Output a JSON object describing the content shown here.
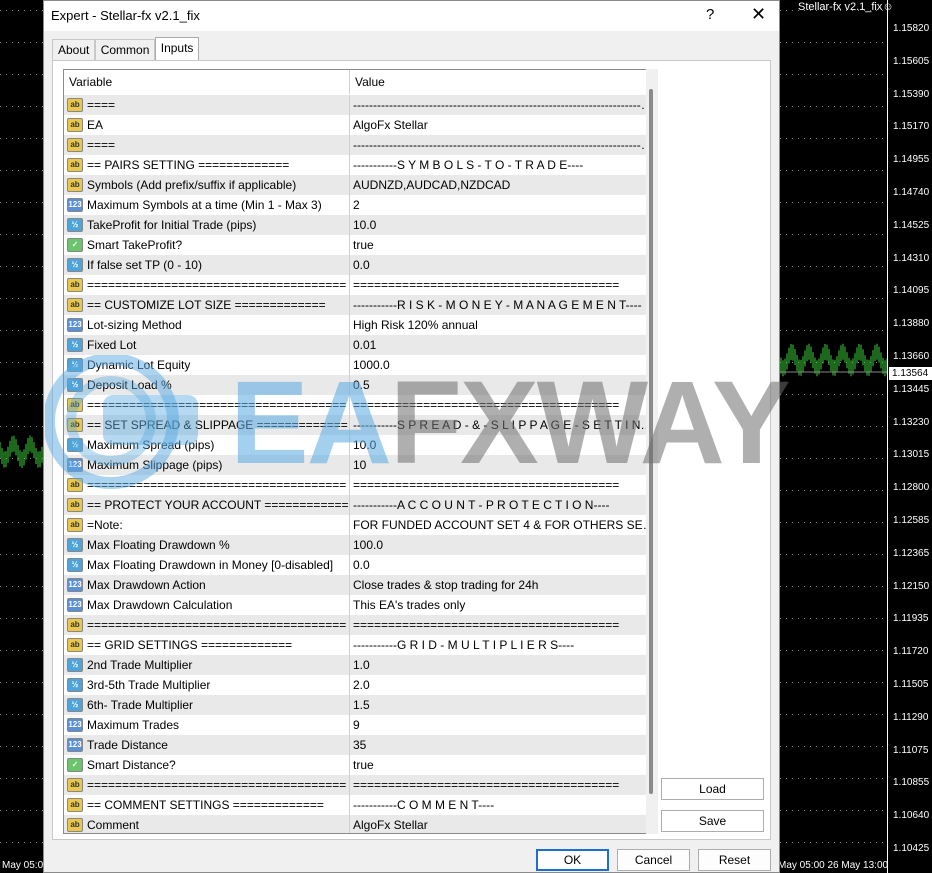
{
  "chart": {
    "title": "Stellar-fx v2.1_fix",
    "prices": [
      "1.15820",
      "1.15605",
      "1.15390",
      "1.15170",
      "1.14955",
      "1.14740",
      "1.14525",
      "1.14310",
      "1.14095",
      "1.13880",
      "1.13660",
      "1.13445",
      "1.13230",
      "1.13015",
      "1.12800",
      "1.12585",
      "1.12365",
      "1.12150",
      "1.11935",
      "1.11720",
      "1.11505",
      "1.11290",
      "1.11075",
      "1.10855",
      "1.10640",
      "1.10425"
    ],
    "current_price": "1.13564",
    "time_left": "May 05:0",
    "time_right": "May 05:00  26 May 13:00"
  },
  "dialog": {
    "title": "Expert - Stellar-fx v2.1_fix",
    "help": "?",
    "close": "✕",
    "tabs": [
      "About",
      "Common",
      "Inputs"
    ],
    "columns": {
      "variable": "Variable",
      "value": "Value"
    },
    "rows": [
      {
        "icon": "ab",
        "var": "====",
        "val": "--------------------------------------------------------------------------------"
      },
      {
        "icon": "ab",
        "var": "EA",
        "val": "AlgoFx Stellar"
      },
      {
        "icon": "ab",
        "var": "====",
        "val": "--------------------------------------------------------------------------------"
      },
      {
        "icon": "ab",
        "var": "== PAIRS SETTING =============",
        "val": "-----------S Y M B O L S - T O - T R A D E----"
      },
      {
        "icon": "ab",
        "var": "Symbols (Add prefix/suffix if applicable)",
        "val": "AUDNZD,AUDCAD,NZDCAD"
      },
      {
        "icon": "123",
        "var": "Maximum Symbols at a time (Min 1 - Max 3)",
        "val": "2"
      },
      {
        "icon": "v2",
        "var": "TakeProfit for Initial Trade (pips)",
        "val": "10.0"
      },
      {
        "icon": "bool",
        "var": "Smart TakeProfit?",
        "val": "true"
      },
      {
        "icon": "v2",
        "var": "If false set TP (0 - 10)",
        "val": "0.0"
      },
      {
        "icon": "ab",
        "var": "=====================================",
        "val": "======================================"
      },
      {
        "icon": "ab",
        "var": "== CUSTOMIZE LOT SIZE =============",
        "val": "-----------R I S K - M O N E Y - M A N A G E M E N T----"
      },
      {
        "icon": "123",
        "var": "Lot-sizing Method",
        "val": "High Risk 120% annual"
      },
      {
        "icon": "v2",
        "var": "Fixed Lot",
        "val": "0.01"
      },
      {
        "icon": "v2",
        "var": "Dynamic Lot Equity",
        "val": "1000.0"
      },
      {
        "icon": "v2",
        "var": "Deposit Load %",
        "val": "0.5"
      },
      {
        "icon": "ab",
        "var": "=====================================",
        "val": "======================================"
      },
      {
        "icon": "ab",
        "var": "== SET SPREAD & SLIPPAGE =============",
        "val": "-----------S P R E A D - & - S L I P P A G E - S E T T I N G----"
      },
      {
        "icon": "v2",
        "var": "Maximum Spread (pips)",
        "val": "10.0"
      },
      {
        "icon": "123",
        "var": "Maximum Slippage (pips)",
        "val": "10"
      },
      {
        "icon": "ab",
        "var": "=====================================",
        "val": "======================================"
      },
      {
        "icon": "ab",
        "var": "== PROTECT YOUR ACCOUNT =============",
        "val": "-----------A C C O U N T - P R O T E C T I O N----"
      },
      {
        "icon": "ab",
        "var": "=Note:",
        "val": "FOR FUNDED ACCOUNT SET 4 & FOR OTHERS SET ..."
      },
      {
        "icon": "v2",
        "var": "Max Floating Drawdown %",
        "val": "100.0"
      },
      {
        "icon": "v2",
        "var": "Max Floating Drawdown in Money [0-disabled]",
        "val": "0.0"
      },
      {
        "icon": "123",
        "var": "Max Drawdown Action",
        "val": "Close trades & stop trading for 24h"
      },
      {
        "icon": "123",
        "var": "Max Drawdown Calculation",
        "val": "This EA's trades only"
      },
      {
        "icon": "ab",
        "var": "=====================================",
        "val": "======================================"
      },
      {
        "icon": "ab",
        "var": "== GRID SETTINGS =============",
        "val": "-----------G R I D - M U L T I P L I E R S----"
      },
      {
        "icon": "v2",
        "var": "2nd Trade Multiplier",
        "val": "1.0"
      },
      {
        "icon": "v2",
        "var": "3rd-5th Trade Multiplier",
        "val": "2.0"
      },
      {
        "icon": "v2",
        "var": "6th- Trade Multiplier",
        "val": "1.5"
      },
      {
        "icon": "123",
        "var": "Maximum Trades",
        "val": "9"
      },
      {
        "icon": "123",
        "var": "Trade Distance",
        "val": "35"
      },
      {
        "icon": "bool",
        "var": "Smart Distance?",
        "val": "true"
      },
      {
        "icon": "ab",
        "var": "=====================================",
        "val": "======================================"
      },
      {
        "icon": "ab",
        "var": "== COMMENT SETTINGS =============",
        "val": "-----------C O M M E N T----"
      },
      {
        "icon": "ab",
        "var": "Comment",
        "val": "AlgoFx Stellar"
      }
    ],
    "side_buttons": {
      "load": "Load",
      "save": "Save"
    },
    "footer_buttons": {
      "ok": "OK",
      "cancel": "Cancel",
      "reset": "Reset"
    }
  },
  "watermark": {
    "part1": "EA",
    "part2": "FXWAY"
  },
  "colors": {
    "candle_up": "#3bd13b",
    "dialog_bg": "#f0f0f0",
    "ok_border": "#1c6fd1"
  }
}
